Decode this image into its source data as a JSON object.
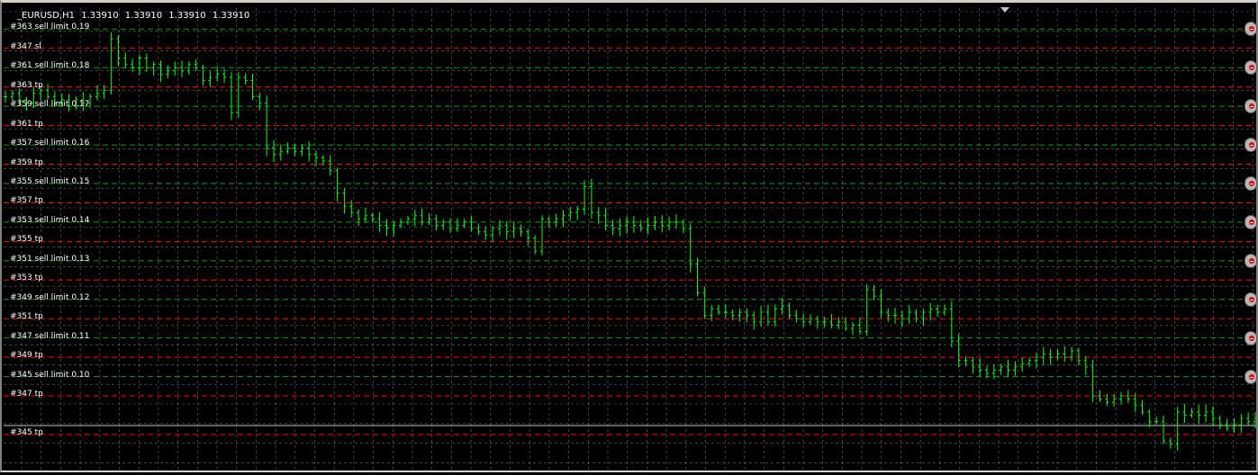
{
  "chart_header": {
    "symbol": "_EURUSD,H1",
    "open": "1.33910",
    "high": "1.33910",
    "low": "1.33910",
    "close": "1.33910"
  },
  "colors": {
    "background": "#000000",
    "grid": "#c0c0c0",
    "candles": "#00ff00",
    "sell_limit_line": "#00a000",
    "tp_sl_line": "#ff0000",
    "price_line": "#c0c0c0"
  },
  "order_lines": [
    {
      "label": "#363 sell limit 0.19",
      "kind": "entry",
      "price": 1.3499
    },
    {
      "label": "#347 sl",
      "kind": "stop",
      "price": 1.3493
    },
    {
      "label": "#361 sell limit 0.18",
      "kind": "entry",
      "price": 1.3487
    },
    {
      "label": "#363 tp",
      "kind": "target",
      "price": 1.3481
    },
    {
      "label": "#359 sell limit 0.17",
      "kind": "entry",
      "price": 1.3475
    },
    {
      "label": "#361 tp",
      "kind": "target",
      "price": 1.3469
    },
    {
      "label": "#357 sell limit 0.16",
      "kind": "entry",
      "price": 1.3463
    },
    {
      "label": "#359 tp",
      "kind": "target",
      "price": 1.3457
    },
    {
      "label": "#355 sell limit 0.15",
      "kind": "entry",
      "price": 1.3451
    },
    {
      "label": "#357 tp",
      "kind": "target",
      "price": 1.3445
    },
    {
      "label": "#353 sell limit 0.14",
      "kind": "entry",
      "price": 1.3439
    },
    {
      "label": "#355 tp",
      "kind": "target",
      "price": 1.3433
    },
    {
      "label": "#351 sell limit 0.13",
      "kind": "entry",
      "price": 1.3427
    },
    {
      "label": "#353 tp",
      "kind": "target",
      "price": 1.3421
    },
    {
      "label": "#349 sell limit 0.12",
      "kind": "entry",
      "price": 1.3415
    },
    {
      "label": "#351 tp",
      "kind": "target",
      "price": 1.3409
    },
    {
      "label": "#347 sell limit 0.11",
      "kind": "entry",
      "price": 1.3403
    },
    {
      "label": "#349 tp",
      "kind": "target",
      "price": 1.3397
    },
    {
      "label": "#345 sell limit 0.10",
      "kind": "entry",
      "price": 1.3391
    },
    {
      "label": "#347 tp",
      "kind": "target",
      "price": 1.3385
    },
    {
      "label": "#345 tp",
      "kind": "target",
      "price": 1.3373
    }
  ],
  "current_price": 1.3391,
  "chart_data": {
    "type": "ohlc",
    "title": "_EURUSD,H1",
    "ylim": [
      1.3366,
      1.3503
    ],
    "close_path": [
      1.3478,
      1.3479,
      1.3477,
      1.3476,
      1.3479,
      1.348,
      1.3478,
      1.3476,
      1.3477,
      1.3475,
      1.3477,
      1.3476,
      1.3478,
      1.3479,
      1.348,
      1.3496,
      1.349,
      1.3488,
      1.3487,
      1.349,
      1.3487,
      1.3488,
      1.3485,
      1.3486,
      1.3487,
      1.3486,
      1.3488,
      1.3487,
      1.3483,
      1.3484,
      1.3485,
      1.3484,
      1.3473,
      1.3484,
      1.3483,
      1.3478,
      1.3476,
      1.3462,
      1.346,
      1.3461,
      1.3462,
      1.3461,
      1.3462,
      1.346,
      1.3459,
      1.3458,
      1.3455,
      1.3448,
      1.3444,
      1.3442,
      1.344,
      1.3441,
      1.344,
      1.3438,
      1.3437,
      1.3438,
      1.3439,
      1.344,
      1.3441,
      1.3439,
      1.344,
      1.3438,
      1.3439,
      1.3437,
      1.3438,
      1.3439,
      1.3437,
      1.3436,
      1.3435,
      1.3437,
      1.3438,
      1.3436,
      1.3437,
      1.3436,
      1.3434,
      1.343,
      1.344,
      1.3439,
      1.344,
      1.3441,
      1.3442,
      1.3443,
      1.345,
      1.3442,
      1.3441,
      1.3438,
      1.3437,
      1.3438,
      1.3439,
      1.3438,
      1.3437,
      1.3438,
      1.3439,
      1.3438,
      1.3439,
      1.3439,
      1.3437,
      1.3426,
      1.3417,
      1.341,
      1.3412,
      1.3411,
      1.3411,
      1.341,
      1.3411,
      1.341,
      1.3408,
      1.3411,
      1.3408,
      1.3412,
      1.3413,
      1.341,
      1.3409,
      1.3408,
      1.3409,
      1.3408,
      1.3408,
      1.3407,
      1.3408,
      1.3406,
      1.3407,
      1.3405,
      1.3418,
      1.3416,
      1.3411,
      1.341,
      1.341,
      1.3409,
      1.3411,
      1.3409,
      1.3411,
      1.3412,
      1.3411,
      1.3412,
      1.3402,
      1.3396,
      1.3396,
      1.3394,
      1.3393,
      1.3392,
      1.3393,
      1.3394,
      1.3393,
      1.3394,
      1.3395,
      1.3396,
      1.3397,
      1.3398,
      1.3397,
      1.3398,
      1.3397,
      1.3399,
      1.3396,
      1.3394,
      1.3385,
      1.3384,
      1.3383,
      1.3384,
      1.3385,
      1.3384,
      1.3382,
      1.338,
      1.3377,
      1.3377,
      1.3371,
      1.337,
      1.338,
      1.3379,
      1.338,
      1.3379,
      1.338,
      1.3378,
      1.3376,
      1.3375,
      1.3376,
      1.3378,
      1.3377,
      1.3378
    ]
  }
}
